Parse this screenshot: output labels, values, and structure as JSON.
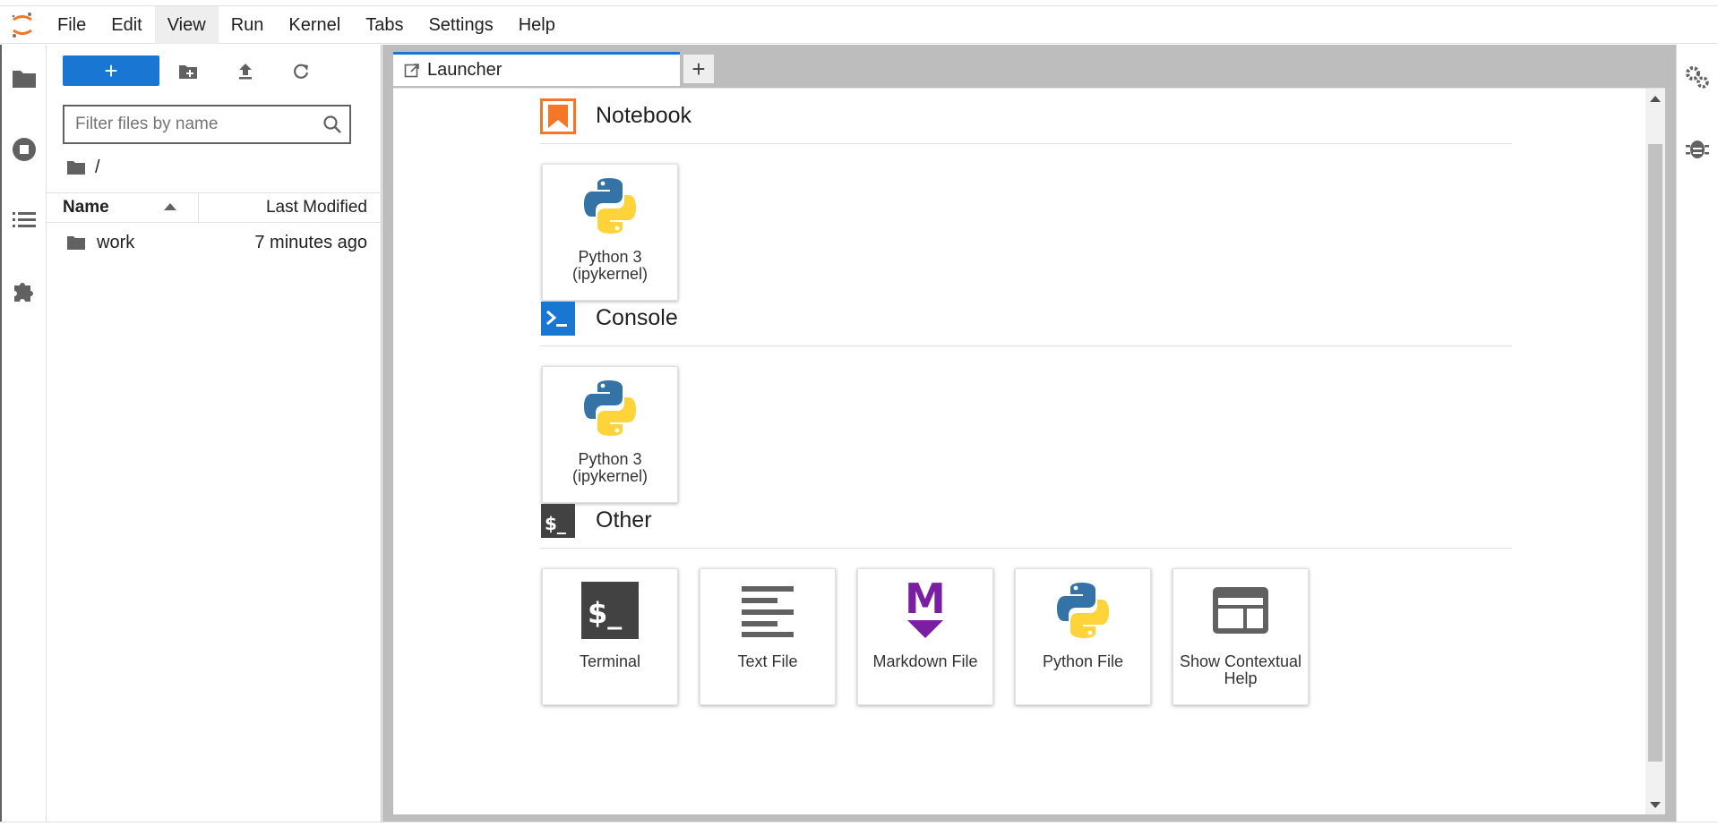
{
  "menubar": {
    "items": [
      {
        "label": "File"
      },
      {
        "label": "Edit"
      },
      {
        "label": "View"
      },
      {
        "label": "Run"
      },
      {
        "label": "Kernel"
      },
      {
        "label": "Tabs"
      },
      {
        "label": "Settings"
      },
      {
        "label": "Help"
      }
    ],
    "active": "View"
  },
  "filebrowser": {
    "new_label": "+",
    "search_placeholder": "Filter files by name",
    "breadcrumb": "/",
    "columns": {
      "name": "Name",
      "modified": "Last Modified"
    },
    "files": [
      {
        "name": "work",
        "modified": "7 minutes ago",
        "icon": "folder-icon"
      }
    ]
  },
  "tabs": [
    {
      "label": "Launcher",
      "icon": "launcher-icon"
    }
  ],
  "tab_add_label": "+",
  "launcher": {
    "sections": [
      {
        "title": "Notebook",
        "icon": "notebook-icon",
        "cards": [
          {
            "label": "Python 3 (ipykernel)",
            "icon": "python-icon"
          }
        ]
      },
      {
        "title": "Console",
        "icon": "console-icon",
        "cards": [
          {
            "label": "Python 3 (ipykernel)",
            "icon": "python-icon"
          }
        ]
      },
      {
        "title": "Other",
        "icon": "other-icon",
        "cards": [
          {
            "label": "Terminal",
            "icon": "terminal-icon"
          },
          {
            "label": "Text File",
            "icon": "text-file-icon"
          },
          {
            "label": "Markdown File",
            "icon": "markdown-icon"
          },
          {
            "label": "Python File",
            "icon": "python-icon"
          },
          {
            "label": "Show Contextual Help",
            "icon": "contextual-help-icon"
          }
        ]
      }
    ]
  },
  "colors": {
    "accent": "#1976d2",
    "notebook_orange": "#f37726",
    "console_blue": "#1976d2",
    "markdown_purple": "#7b1fa2",
    "python_blue": "#3572A5",
    "python_yellow": "#FFD43B"
  }
}
